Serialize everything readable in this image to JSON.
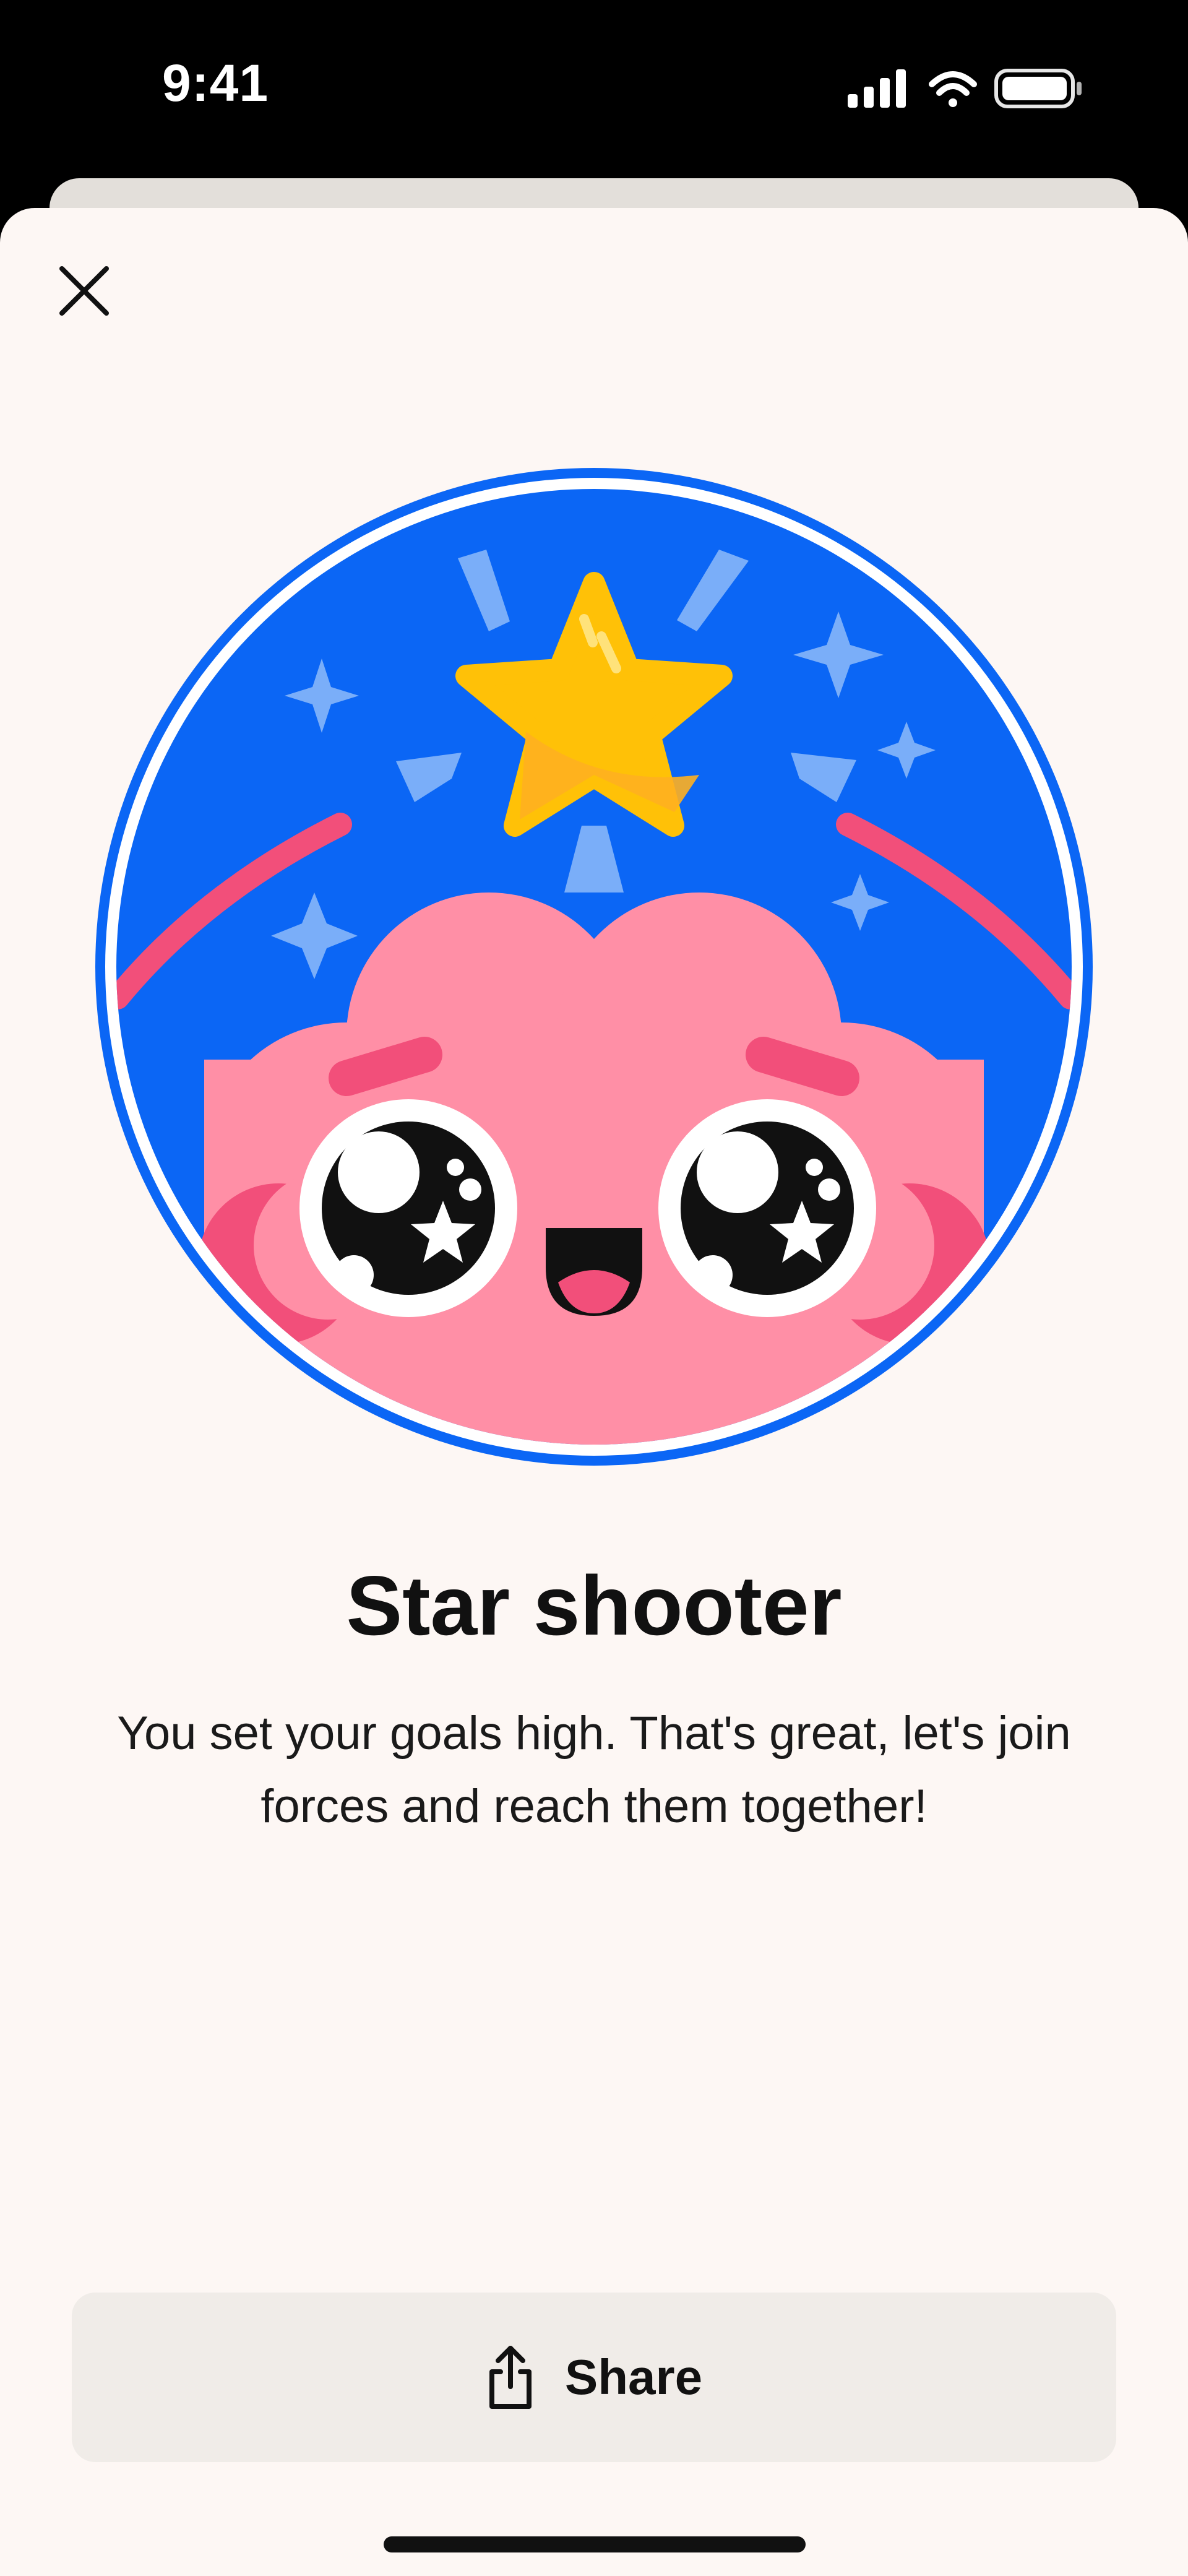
{
  "status_bar": {
    "time": "9:41",
    "icons": [
      "cellular-signal-icon",
      "wifi-icon",
      "battery-icon"
    ]
  },
  "modal": {
    "close_icon": "close-icon"
  },
  "badge": {
    "illustration": "star-shooter-brain-badge",
    "colors": {
      "ring": "#0b66f5",
      "background": "#0b66f5",
      "star": "#ffc107",
      "brain": "#ff8fa6",
      "accent": "#f24f7a"
    }
  },
  "achievement": {
    "title": "Star shooter",
    "description": "You set your goals high. That's great, let's join forces and reach them together!"
  },
  "share": {
    "label": "Share",
    "icon": "share-icon"
  }
}
